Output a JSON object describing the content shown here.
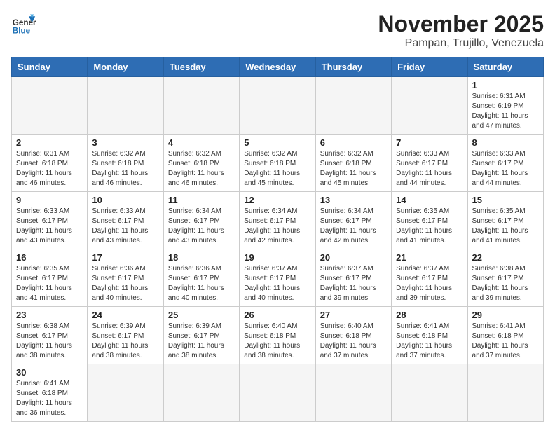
{
  "header": {
    "logo_general": "General",
    "logo_blue": "Blue",
    "title": "November 2025",
    "subtitle": "Pampan, Trujillo, Venezuela"
  },
  "weekdays": [
    "Sunday",
    "Monday",
    "Tuesday",
    "Wednesday",
    "Thursday",
    "Friday",
    "Saturday"
  ],
  "weeks": [
    [
      {
        "day": "",
        "info": ""
      },
      {
        "day": "",
        "info": ""
      },
      {
        "day": "",
        "info": ""
      },
      {
        "day": "",
        "info": ""
      },
      {
        "day": "",
        "info": ""
      },
      {
        "day": "",
        "info": ""
      },
      {
        "day": "1",
        "info": "Sunrise: 6:31 AM\nSunset: 6:19 PM\nDaylight: 11 hours\nand 47 minutes."
      }
    ],
    [
      {
        "day": "2",
        "info": "Sunrise: 6:31 AM\nSunset: 6:18 PM\nDaylight: 11 hours\nand 46 minutes."
      },
      {
        "day": "3",
        "info": "Sunrise: 6:32 AM\nSunset: 6:18 PM\nDaylight: 11 hours\nand 46 minutes."
      },
      {
        "day": "4",
        "info": "Sunrise: 6:32 AM\nSunset: 6:18 PM\nDaylight: 11 hours\nand 46 minutes."
      },
      {
        "day": "5",
        "info": "Sunrise: 6:32 AM\nSunset: 6:18 PM\nDaylight: 11 hours\nand 45 minutes."
      },
      {
        "day": "6",
        "info": "Sunrise: 6:32 AM\nSunset: 6:18 PM\nDaylight: 11 hours\nand 45 minutes."
      },
      {
        "day": "7",
        "info": "Sunrise: 6:33 AM\nSunset: 6:17 PM\nDaylight: 11 hours\nand 44 minutes."
      },
      {
        "day": "8",
        "info": "Sunrise: 6:33 AM\nSunset: 6:17 PM\nDaylight: 11 hours\nand 44 minutes."
      }
    ],
    [
      {
        "day": "9",
        "info": "Sunrise: 6:33 AM\nSunset: 6:17 PM\nDaylight: 11 hours\nand 43 minutes."
      },
      {
        "day": "10",
        "info": "Sunrise: 6:33 AM\nSunset: 6:17 PM\nDaylight: 11 hours\nand 43 minutes."
      },
      {
        "day": "11",
        "info": "Sunrise: 6:34 AM\nSunset: 6:17 PM\nDaylight: 11 hours\nand 43 minutes."
      },
      {
        "day": "12",
        "info": "Sunrise: 6:34 AM\nSunset: 6:17 PM\nDaylight: 11 hours\nand 42 minutes."
      },
      {
        "day": "13",
        "info": "Sunrise: 6:34 AM\nSunset: 6:17 PM\nDaylight: 11 hours\nand 42 minutes."
      },
      {
        "day": "14",
        "info": "Sunrise: 6:35 AM\nSunset: 6:17 PM\nDaylight: 11 hours\nand 41 minutes."
      },
      {
        "day": "15",
        "info": "Sunrise: 6:35 AM\nSunset: 6:17 PM\nDaylight: 11 hours\nand 41 minutes."
      }
    ],
    [
      {
        "day": "16",
        "info": "Sunrise: 6:35 AM\nSunset: 6:17 PM\nDaylight: 11 hours\nand 41 minutes."
      },
      {
        "day": "17",
        "info": "Sunrise: 6:36 AM\nSunset: 6:17 PM\nDaylight: 11 hours\nand 40 minutes."
      },
      {
        "day": "18",
        "info": "Sunrise: 6:36 AM\nSunset: 6:17 PM\nDaylight: 11 hours\nand 40 minutes."
      },
      {
        "day": "19",
        "info": "Sunrise: 6:37 AM\nSunset: 6:17 PM\nDaylight: 11 hours\nand 40 minutes."
      },
      {
        "day": "20",
        "info": "Sunrise: 6:37 AM\nSunset: 6:17 PM\nDaylight: 11 hours\nand 39 minutes."
      },
      {
        "day": "21",
        "info": "Sunrise: 6:37 AM\nSunset: 6:17 PM\nDaylight: 11 hours\nand 39 minutes."
      },
      {
        "day": "22",
        "info": "Sunrise: 6:38 AM\nSunset: 6:17 PM\nDaylight: 11 hours\nand 39 minutes."
      }
    ],
    [
      {
        "day": "23",
        "info": "Sunrise: 6:38 AM\nSunset: 6:17 PM\nDaylight: 11 hours\nand 38 minutes."
      },
      {
        "day": "24",
        "info": "Sunrise: 6:39 AM\nSunset: 6:17 PM\nDaylight: 11 hours\nand 38 minutes."
      },
      {
        "day": "25",
        "info": "Sunrise: 6:39 AM\nSunset: 6:17 PM\nDaylight: 11 hours\nand 38 minutes."
      },
      {
        "day": "26",
        "info": "Sunrise: 6:40 AM\nSunset: 6:18 PM\nDaylight: 11 hours\nand 38 minutes."
      },
      {
        "day": "27",
        "info": "Sunrise: 6:40 AM\nSunset: 6:18 PM\nDaylight: 11 hours\nand 37 minutes."
      },
      {
        "day": "28",
        "info": "Sunrise: 6:41 AM\nSunset: 6:18 PM\nDaylight: 11 hours\nand 37 minutes."
      },
      {
        "day": "29",
        "info": "Sunrise: 6:41 AM\nSunset: 6:18 PM\nDaylight: 11 hours\nand 37 minutes."
      }
    ],
    [
      {
        "day": "30",
        "info": "Sunrise: 6:41 AM\nSunset: 6:18 PM\nDaylight: 11 hours\nand 36 minutes."
      },
      {
        "day": "",
        "info": ""
      },
      {
        "day": "",
        "info": ""
      },
      {
        "day": "",
        "info": ""
      },
      {
        "day": "",
        "info": ""
      },
      {
        "day": "",
        "info": ""
      },
      {
        "day": "",
        "info": ""
      }
    ]
  ]
}
